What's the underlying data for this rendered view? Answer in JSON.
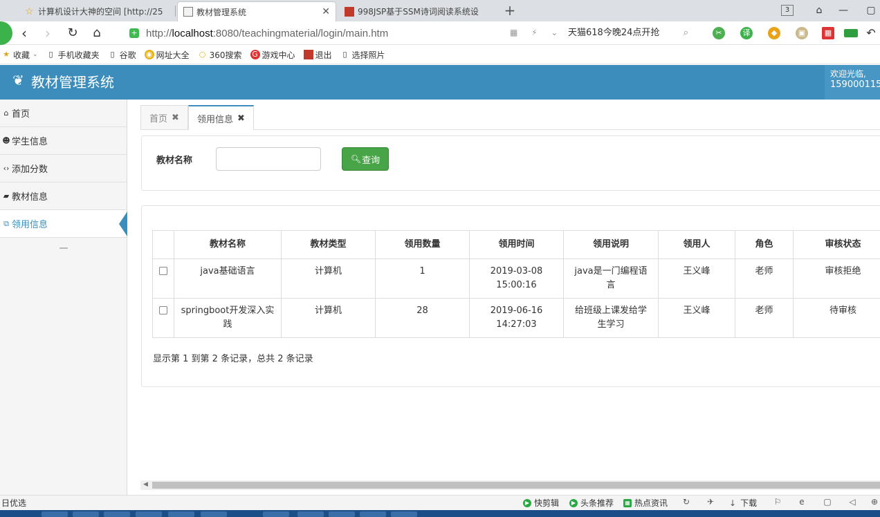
{
  "browser": {
    "tabs": [
      {
        "label": "计算机设计大神的空间 [http://25",
        "active": false
      },
      {
        "label": "教材管理系统",
        "active": true
      },
      {
        "label": "998JSP基于SSM诗词阅读系统设",
        "active": false
      }
    ],
    "tab_count": "3",
    "url_prefix": "http://",
    "url_host": "localhost",
    "url_rest": ":8080/teachingmaterial/login/main.htm",
    "search_hint": "天猫618今晚24点开抢",
    "bookmarks": [
      "收藏",
      "手机收藏夹",
      "谷歌",
      "网址大全",
      "360搜索",
      "游戏中心",
      "退出",
      "选择照片"
    ]
  },
  "app": {
    "title": "教材管理系统",
    "welcome": "欢迎光临,",
    "user_id": "159000115"
  },
  "sidebar": {
    "items": [
      {
        "label": "首页",
        "icon": "home-icon"
      },
      {
        "label": "学生信息",
        "icon": "users-icon"
      },
      {
        "label": "添加分数",
        "icon": "code-icon"
      },
      {
        "label": "教材信息",
        "icon": "book-icon"
      },
      {
        "label": "领用信息",
        "icon": "window-icon",
        "active": true
      }
    ]
  },
  "content_tabs": [
    {
      "label": "首页",
      "active": false
    },
    {
      "label": "领用信息",
      "active": true
    }
  ],
  "search": {
    "label": "教材名称",
    "value": "",
    "button": "查询"
  },
  "table": {
    "headers": [
      "教材名称",
      "教材类型",
      "领用数量",
      "领用时间",
      "领用说明",
      "领用人",
      "角色",
      "审核状态"
    ],
    "rows": [
      {
        "name": "java基础语言",
        "type": "计算机",
        "qty": "1",
        "time": "2019-03-08 15:00:16",
        "desc": "java是一门编程语言",
        "person": "王义峰",
        "role": "老师",
        "status": "审核拒绝"
      },
      {
        "name": "springboot开发深入实践",
        "type": "计算机",
        "qty": "28",
        "time": "2019-06-16 14:27:03",
        "desc": "给班级上课发给学生学习",
        "person": "王义峰",
        "role": "老师",
        "status": "待审核"
      }
    ],
    "page_info": "显示第 1 到第 2 条记录，总共 2 条记录"
  },
  "statusbar": {
    "left": "日优选",
    "items": [
      "快剪辑",
      "头条推荐",
      "热点资讯",
      "下载"
    ]
  },
  "colors": {
    "header": "#3c8dbc",
    "search_button": "#47a447",
    "active_nav": "#3c8dbc"
  }
}
